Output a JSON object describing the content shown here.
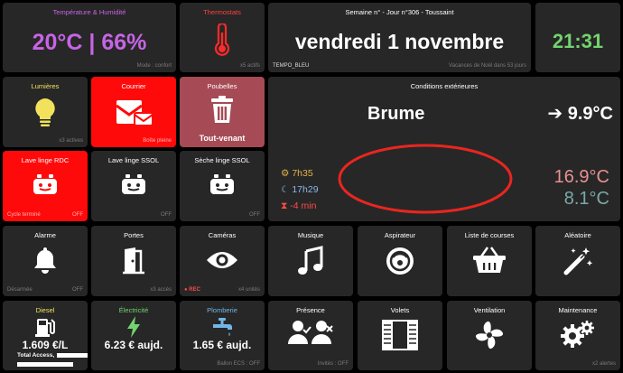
{
  "row1": {
    "temp": {
      "title": "Température & Humidité",
      "value": "20°C | 66%",
      "footer": "Mode : confort"
    },
    "thermostats": {
      "title": "Thermostats",
      "footer": "x5 actifs"
    },
    "date": {
      "subtitle": "Semaine n° - Jour n°306 - Toussaint",
      "value": "vendredi 1 novembre",
      "tempo": "TEMPO_BLEU",
      "holiday": "Vacances de Noël dans 53 jours"
    },
    "clock": {
      "time": "21:31"
    }
  },
  "row2": {
    "lumieres": {
      "title": "Lumières",
      "footer": "x3 actives"
    },
    "courrier": {
      "title": "Courrier",
      "footer": "Boîte pleine"
    },
    "poubelles": {
      "title": "Poubelles",
      "label": "Tout-venant"
    },
    "lavage_rdc": {
      "title": "Lave linge RDC",
      "footer_left": "Cycle terminé",
      "footer_right": "OFF"
    },
    "lavage_ssol": {
      "title": "Lave linge SSOL",
      "footer": "OFF"
    },
    "sechage_ssol": {
      "title": "Sèche linge SSOL",
      "footer": "OFF"
    }
  },
  "weather": {
    "title": "Conditions extérieures",
    "condition": "Brume",
    "wind_arrow": "➔",
    "current_temp": "9.9°C",
    "sunrise": "7h35",
    "sunset": "17h29",
    "daylight_delta": "-4 min",
    "temp_max": "16.9°C",
    "temp_min": "8.1°C"
  },
  "row3": {
    "alarme": {
      "title": "Alarme",
      "footer_left": "Désarmée",
      "footer_right": "OFF"
    },
    "portes": {
      "title": "Portes",
      "footer": "x3 accès"
    },
    "cameras": {
      "title": "Caméras",
      "rec": "REC",
      "footer": "x4 unités"
    },
    "musique": {
      "title": "Musique"
    },
    "aspirateur": {
      "title": "Aspirateur"
    },
    "courses": {
      "title": "Liste de courses"
    },
    "aleatoire": {
      "title": "Aléatoire"
    }
  },
  "row4": {
    "diesel": {
      "title": "Diesel",
      "value": "1.609 €/L",
      "sub": "Total Access,"
    },
    "electricite": {
      "title": "Électricité",
      "value": "6.23 € aujd."
    },
    "plomberie": {
      "title": "Plomberie",
      "value": "1.65 € aujd.",
      "footer": "Ballon ECS : OFF"
    },
    "presence": {
      "title": "Présence",
      "footer": "Invités : OFF"
    },
    "volets": {
      "title": "Volets"
    },
    "ventilation": {
      "title": "Ventilation"
    },
    "maintenance": {
      "title": "Maintenance",
      "footer": "x2 alertes"
    }
  },
  "colors": {
    "tile": "#272727",
    "purple": "#c764e6",
    "red": "#ff0a0a",
    "rose": "#a64a55",
    "yellow": "#f2e15c",
    "green": "#73d36f",
    "blue": "#72b6e8",
    "orange": "#e3b34a",
    "warm": "#e89090",
    "cool": "#7aa9a9"
  }
}
